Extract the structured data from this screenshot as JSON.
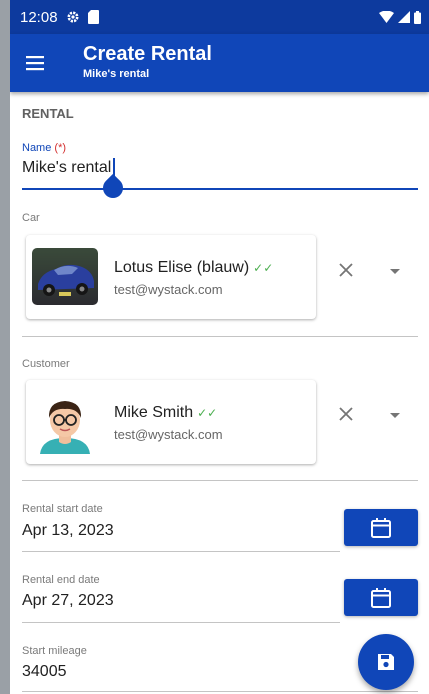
{
  "status_bar": {
    "time": "12:08"
  },
  "app_bar": {
    "title": "Create Rental",
    "subtitle": "Mike's rental"
  },
  "form": {
    "section": "RENTAL",
    "name": {
      "label": "Name",
      "required_marker": "(*)",
      "value": "Mike's rental"
    },
    "car": {
      "label": "Car",
      "title": "Lotus Elise (blauw)",
      "verified_glyph": "✓✓",
      "subtitle": "test@wystack.com"
    },
    "customer": {
      "label": "Customer",
      "title": "Mike Smith",
      "verified_glyph": "✓✓",
      "subtitle": "test@wystack.com"
    },
    "rental_start": {
      "label": "Rental start date",
      "value": "Apr 13, 2023"
    },
    "rental_end": {
      "label": "Rental end date",
      "value": "Apr 27, 2023"
    },
    "start_mileage": {
      "label": "Start mileage",
      "value": "34005"
    }
  },
  "colors": {
    "primary": "#1046b8",
    "status_bar": "#0d3a9e",
    "verified": "#4caf50",
    "required": "#d32f2f"
  },
  "icons": [
    "gear-icon",
    "sim-card-icon",
    "wifi-icon",
    "signal-icon",
    "battery-icon",
    "menu-icon",
    "close-icon",
    "dropdown-arrow-icon",
    "calendar-icon",
    "save-icon"
  ]
}
